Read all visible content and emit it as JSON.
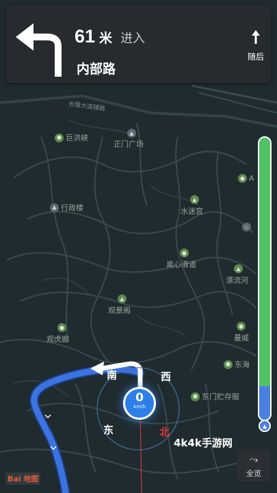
{
  "nav": {
    "distance": "61",
    "unit": "米",
    "action": "进入",
    "road": "内部路",
    "next_label": "随后"
  },
  "map": {
    "road_labels": [
      "长隆大道辅路"
    ],
    "pois": [
      {
        "label": "巨洪峡",
        "type": "park"
      },
      {
        "label": "正门广场",
        "type": "building"
      },
      {
        "label": "行政楼",
        "type": "building"
      },
      {
        "label": "水迷宫",
        "type": "park"
      },
      {
        "label": "离心滑道",
        "type": "park"
      },
      {
        "label": "漂流河",
        "type": "park"
      },
      {
        "label": "观景阁",
        "type": "park"
      },
      {
        "label": "观虎廊",
        "type": "park"
      },
      {
        "label": "曼威",
        "type": "park"
      },
      {
        "label": "东海",
        "type": "park"
      },
      {
        "label": "东门贮存服",
        "type": "park"
      },
      {
        "label": "A",
        "type": "park"
      }
    ]
  },
  "compass": {
    "north": "北",
    "south": "南",
    "east": "东",
    "west": "西"
  },
  "speed": {
    "value": "0",
    "unit": "km/h"
  },
  "progress": {
    "remaining_fraction": 0.88,
    "done_fraction": 0.12
  },
  "overview": {
    "label": "全览"
  },
  "watermark": "4k4k手游网",
  "logo": "Bai 地图",
  "colors": {
    "route": "#3b74e0",
    "progress_green": "#53c165",
    "panel": "#272b30",
    "map_bg": "#1f2b2f"
  }
}
